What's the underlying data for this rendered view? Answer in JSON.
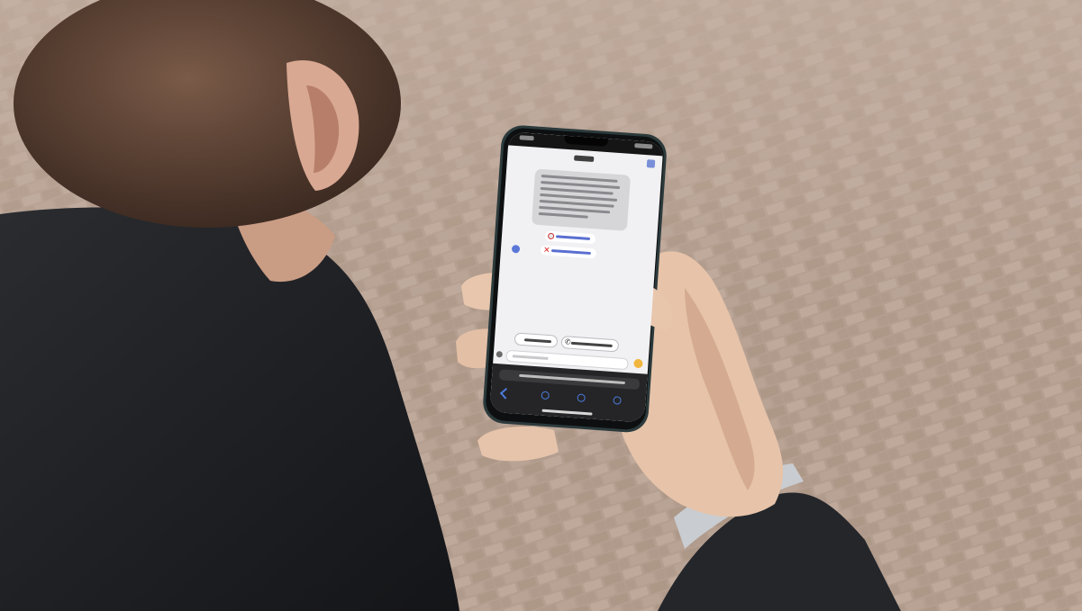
{
  "scene": {
    "colors": {
      "pavement": "#b39d90",
      "pavement_grout": "#9c8878",
      "jacket": "#1d1f22",
      "hair": "#5a4032",
      "skin": "#e2bfa6",
      "phone_body": "#2c3a3c",
      "screen_bg": "#f1f1f3",
      "accent": "#5b78d8"
    }
  },
  "phone": {
    "chat": {
      "bubble_text": "",
      "options": [
        {
          "icon": "flag-icon",
          "label": ""
        },
        {
          "icon": "cross-icon",
          "label": ""
        }
      ],
      "actions": [
        {
          "icon": "",
          "label": ""
        },
        {
          "icon": "phone-icon",
          "label": ""
        }
      ],
      "input_placeholder": ""
    },
    "browser": {
      "url": ""
    }
  }
}
